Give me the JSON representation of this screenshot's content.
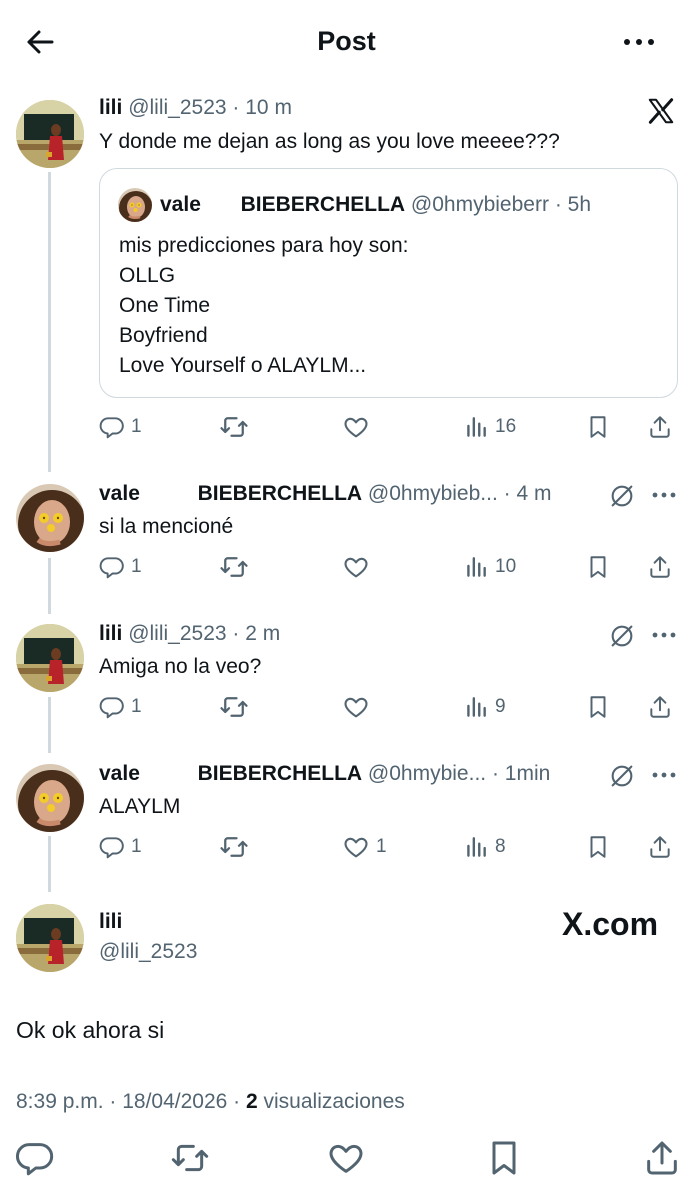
{
  "header": {
    "title": "Post"
  },
  "main_post": {
    "name": "lili",
    "handle": "@lili_2523",
    "time": "· 10 m",
    "text": "Y donde me dejan as long as you love meeee???",
    "quote": {
      "name": "vale",
      "display": "BIEBERCHELLA",
      "handle": "@0hmybieberr",
      "time": "· 5h",
      "lines": [
        "mis predicciones para hoy son:",
        "OLLG",
        "One Time",
        "Boyfriend",
        "Love Yourself o ALAYLM..."
      ]
    },
    "stats": {
      "replies": "1",
      "retweets": "",
      "likes": "",
      "views": "16"
    }
  },
  "replies": [
    {
      "name": "vale",
      "display": "BIEBERCHELLA",
      "handle": "@0hmybieb...",
      "time": "· 4 m",
      "text": "si la mencioné",
      "stats": {
        "replies": "1",
        "likes": "",
        "views": "10"
      }
    },
    {
      "name": "lili",
      "display": "",
      "handle": "@lili_2523",
      "time": "· 2 m",
      "text": "Amiga no la veo?",
      "stats": {
        "replies": "1",
        "likes": "",
        "views": "9"
      }
    },
    {
      "name": "vale",
      "display": "BIEBERCHELLA",
      "handle": "@0hmybie...",
      "time": "· 1min",
      "text": "ALAYLM",
      "stats": {
        "replies": "1",
        "likes": "1",
        "views": "8"
      }
    }
  ],
  "final_post": {
    "name": "lili",
    "handle": "@lili_2523",
    "watermark": "X.com",
    "text": "Ok ok ahora si",
    "timestamp": "8:39 p.m. · 18/04/2026 ·",
    "views_count": "2",
    "views_label": "visualizaciones"
  },
  "colors": {
    "text": "#0f1419",
    "secondary": "#536471",
    "border": "#cfd9de"
  },
  "icons": [
    "back-arrow-icon",
    "more-icon",
    "x-logo-icon",
    "reply-icon",
    "retweet-icon",
    "like-icon",
    "views-icon",
    "bookmark-icon",
    "share-icon",
    "grok-icon"
  ]
}
